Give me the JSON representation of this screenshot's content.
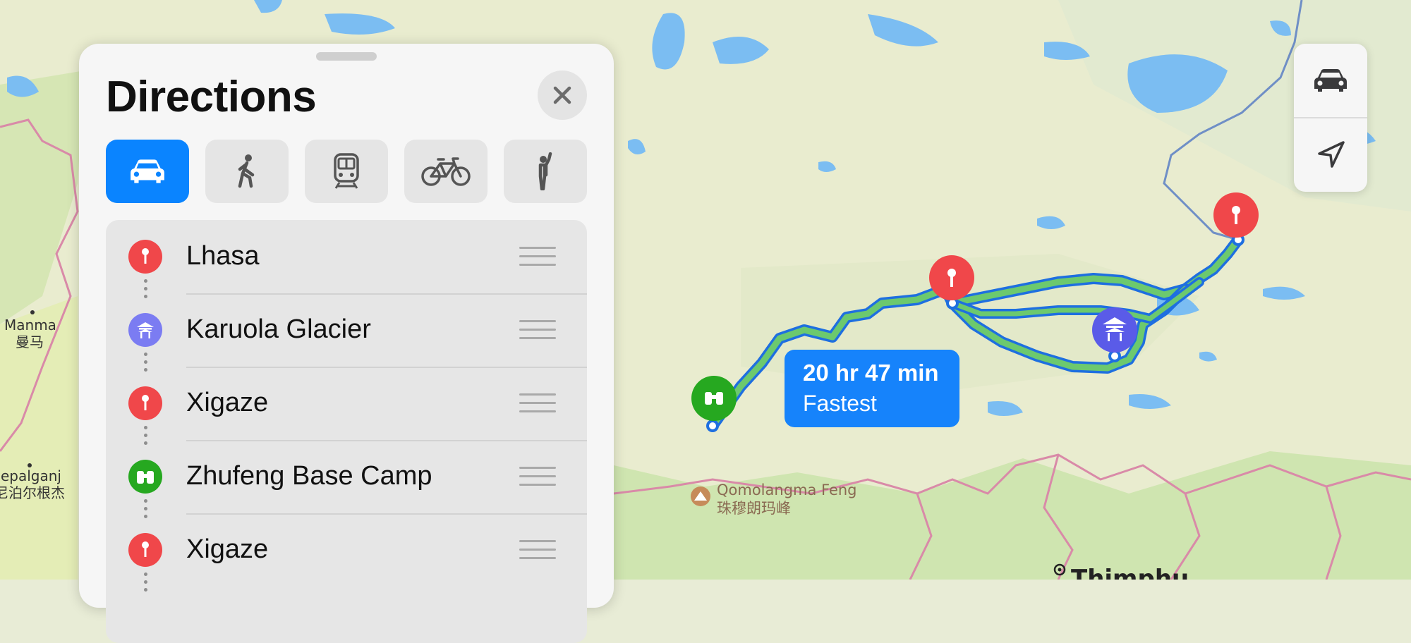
{
  "panel": {
    "title": "Directions",
    "close_label": "Close",
    "modes": [
      {
        "name": "drive",
        "icon": "car-icon",
        "active": true
      },
      {
        "name": "walk",
        "icon": "walking-person-icon",
        "active": false
      },
      {
        "name": "transit",
        "icon": "train-icon",
        "active": false
      },
      {
        "name": "cycle",
        "icon": "bicycle-icon",
        "active": false
      },
      {
        "name": "ride-share",
        "icon": "hailing-person-icon",
        "active": false
      }
    ],
    "stops": [
      {
        "label": "Lhasa",
        "icon": "pin-icon",
        "color": "#f0474a"
      },
      {
        "label": "Karuola Glacier",
        "icon": "pagoda-icon",
        "color": "#7b7cf2"
      },
      {
        "label": "Xigaze",
        "icon": "pin-icon",
        "color": "#f0474a"
      },
      {
        "label": "Zhufeng Base Camp",
        "icon": "binoculars-icon",
        "color": "#26a820"
      },
      {
        "label": "Xigaze",
        "icon": "pin-icon",
        "color": "#f0474a"
      }
    ]
  },
  "route": {
    "time": "20 hr 47 min",
    "label": "Fastest"
  },
  "map": {
    "labels": {
      "manma_en": "Manma",
      "manma_zh": "曼马",
      "nepalganj_en": "Nepalganj",
      "nepalganj_zh": "尼泊尔根杰",
      "qomolangma_en": "Qomolangma Feng",
      "qomolangma_zh": "珠穆朗玛峰",
      "thimphu": "Thimphu"
    }
  },
  "controls": {
    "drive_icon": "car-icon",
    "location_icon": "location-arrow-icon"
  },
  "colors": {
    "accent": "#0a84ff",
    "route": "#1e6fe0",
    "route_fill": "#6cc96e",
    "pin_red": "#f0474a",
    "pin_purple": "#5a5be8",
    "pin_green": "#26a820"
  }
}
